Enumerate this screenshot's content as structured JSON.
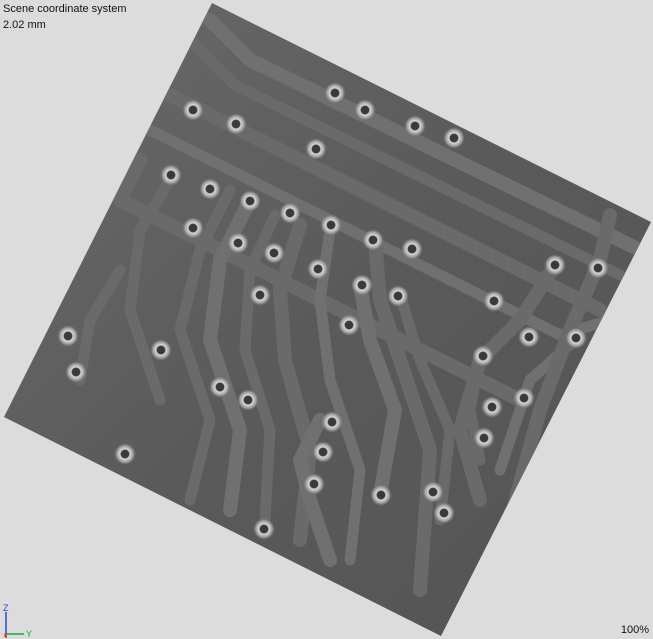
{
  "overlay": {
    "coordinate_system_label": "Scene coordinate system",
    "scale_label": "2.02 mm",
    "zoom_label": "100%"
  },
  "axes": {
    "z_label": "Z",
    "y_label": "Y",
    "x_color": "#e0201c",
    "y_color": "#22a83a",
    "z_color": "#2a4ad8"
  },
  "scene": {
    "content": "circuit-board-surface",
    "surface_color": "#5e5e5e",
    "trace_color": "#6e6e6e",
    "via_color": "#c9c9c9"
  }
}
